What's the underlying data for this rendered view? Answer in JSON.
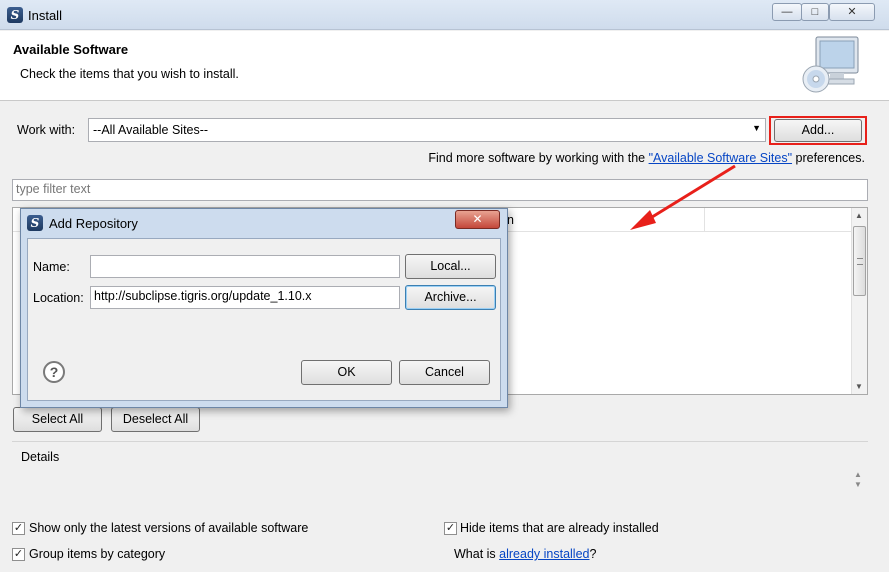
{
  "window": {
    "title": "Install",
    "minimize_glyph": "—",
    "maximize_glyph": "□",
    "close_glyph": "✕"
  },
  "header": {
    "title": "Available Software",
    "subtitle": "Check the items that you wish to install."
  },
  "work_with": {
    "label": "Work with:",
    "value": "--All Available Sites--",
    "add_button": "Add...",
    "find_more_prefix": "Find more software by working with the ",
    "find_more_link": "\"Available Software Sites\"",
    "find_more_suffix": " preferences."
  },
  "filter": {
    "placeholder": "type filter text"
  },
  "tree": {
    "visible_column_fragment": "n"
  },
  "selection_buttons": {
    "select_all": "Select All",
    "deselect_all": "Deselect All"
  },
  "details": {
    "label": "Details"
  },
  "options": {
    "show_latest": {
      "label": "Show only the latest versions of available software",
      "checked": true
    },
    "hide_installed": {
      "label": "Hide items that are already installed",
      "checked": true
    },
    "group_by_category": {
      "label": "Group items by category",
      "checked": true
    },
    "what_is_prefix": "What is ",
    "what_is_link": "already installed",
    "what_is_suffix": "?"
  },
  "dialog": {
    "title": "Add Repository",
    "close_glyph": "✕",
    "name_label": "Name:",
    "name_value": "",
    "location_label": "Location:",
    "location_value": "http://subclipse.tigris.org/update_1.10.x",
    "local_button": "Local...",
    "archive_button": "Archive...",
    "ok_button": "OK",
    "cancel_button": "Cancel",
    "help_glyph": "?"
  },
  "annotation": {
    "arrow_color": "#e8201a",
    "highlight_color": "#e8201a"
  }
}
